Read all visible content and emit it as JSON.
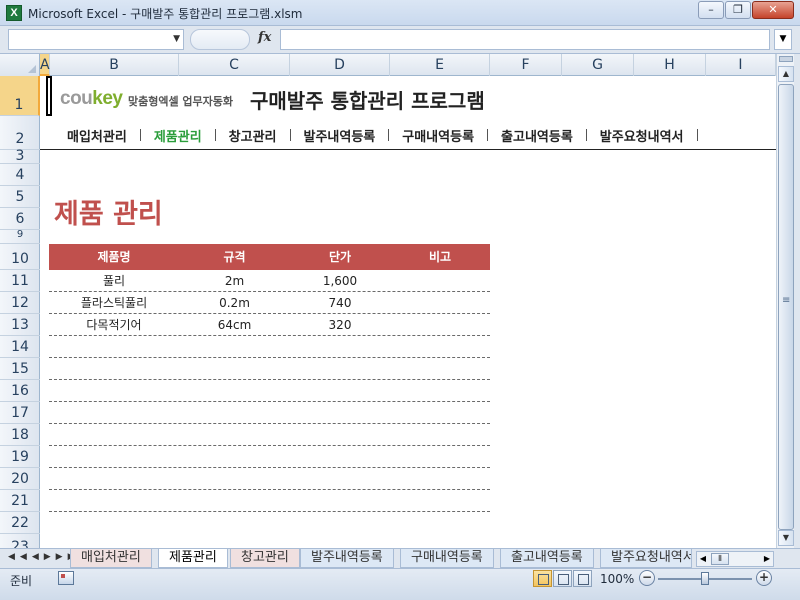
{
  "window": {
    "title": "Microsoft Excel - 구매발주 통합관리 프로그램.xlsm",
    "app_icon_glyph": "X",
    "min_glyph": "–",
    "max_glyph": "❐",
    "close_glyph": "✕"
  },
  "formula_bar": {
    "name_box": "",
    "fx_label": "fx",
    "formula": ""
  },
  "columns": [
    "A",
    "B",
    "C",
    "D",
    "E",
    "F",
    "G",
    "H",
    "I"
  ],
  "rows": [
    "1",
    "2",
    "3",
    "4",
    "5",
    "6",
    "9",
    "10",
    "11",
    "12",
    "13",
    "14",
    "15",
    "16",
    "17",
    "18",
    "19",
    "20",
    "21",
    "22",
    "23"
  ],
  "brand": {
    "logo_a": "cou",
    "logo_b": "key",
    "tagline": "맞춤형엑셀 업무자동화",
    "key_color": "#7fae2e"
  },
  "header": {
    "title": "구매발주 통합관리 프로그램"
  },
  "nav": {
    "items": [
      "매입처관리",
      "제품관리",
      "창고관리",
      "발주내역등록",
      "구매내역등록",
      "출고내역등록",
      "발주요청내역서"
    ],
    "active": "제품관리",
    "active_color": "#2a9d3a"
  },
  "section": {
    "title": "제품 관리",
    "color": "#c0504d"
  },
  "table": {
    "header_color": "#c0504d",
    "columns": [
      "제품명",
      "규격",
      "단가",
      "비고"
    ],
    "rows": [
      [
        "풀리",
        "2m",
        "1,600",
        ""
      ],
      [
        "플라스틱풀리",
        "0.2m",
        "740",
        ""
      ],
      [
        "다목적기어",
        "64cm",
        "320",
        ""
      ],
      [
        "",
        "",
        "",
        ""
      ],
      [
        "",
        "",
        "",
        ""
      ],
      [
        "",
        "",
        "",
        ""
      ],
      [
        "",
        "",
        "",
        ""
      ],
      [
        "",
        "",
        "",
        ""
      ],
      [
        "",
        "",
        "",
        ""
      ],
      [
        "",
        "",
        "",
        ""
      ],
      [
        "",
        "",
        "",
        ""
      ]
    ]
  },
  "sheet_tabs": {
    "items": [
      "매입처관리",
      "제품관리",
      "창고관리",
      "발주내역등록",
      "구매내역등록",
      "출고내역등록",
      "발주요청내역서"
    ],
    "active": "제품관리"
  },
  "status": {
    "mode": "준비",
    "zoom": "100%",
    "zoom_minus": "−",
    "zoom_plus": "+"
  }
}
